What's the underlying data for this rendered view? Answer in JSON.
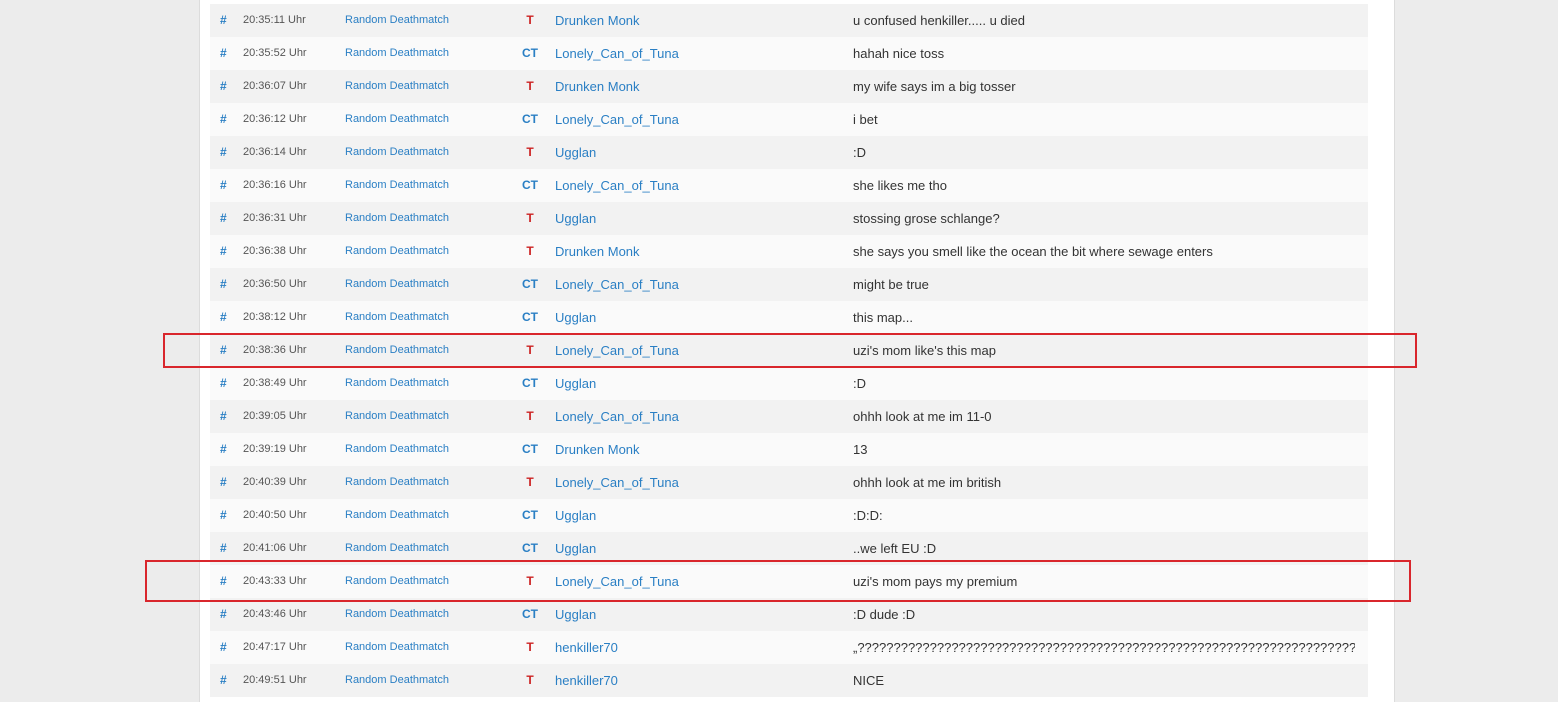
{
  "colors": {
    "link": "#2a7fc4",
    "team_t": "#cc2222",
    "team_ct": "#2a7fc4",
    "highlight": "#d9262c"
  },
  "icons": {
    "scroll_up": "chevron-up-icon"
  },
  "rows": [
    {
      "hash": "#",
      "time": "20:35:11 Uhr",
      "server": "Random Deathmatch",
      "team": "T",
      "player": "Drunken Monk",
      "message": "u confused henkiller..... u died"
    },
    {
      "hash": "#",
      "time": "20:35:52 Uhr",
      "server": "Random Deathmatch",
      "team": "CT",
      "player": "Lonely_Can_of_Tuna",
      "message": "hahah nice toss"
    },
    {
      "hash": "#",
      "time": "20:36:07 Uhr",
      "server": "Random Deathmatch",
      "team": "T",
      "player": "Drunken Monk",
      "message": "my wife says im a big tosser"
    },
    {
      "hash": "#",
      "time": "20:36:12 Uhr",
      "server": "Random Deathmatch",
      "team": "CT",
      "player": "Lonely_Can_of_Tuna",
      "message": "i bet"
    },
    {
      "hash": "#",
      "time": "20:36:14 Uhr",
      "server": "Random Deathmatch",
      "team": "T",
      "player": "Ugglan",
      "message": ":D"
    },
    {
      "hash": "#",
      "time": "20:36:16 Uhr",
      "server": "Random Deathmatch",
      "team": "CT",
      "player": "Lonely_Can_of_Tuna",
      "message": "she likes me tho"
    },
    {
      "hash": "#",
      "time": "20:36:31 Uhr",
      "server": "Random Deathmatch",
      "team": "T",
      "player": "Ugglan",
      "message": "stossing grose schlange?"
    },
    {
      "hash": "#",
      "time": "20:36:38 Uhr",
      "server": "Random Deathmatch",
      "team": "T",
      "player": "Drunken Monk",
      "message": "she says you smell like the ocean the bit where sewage enters"
    },
    {
      "hash": "#",
      "time": "20:36:50 Uhr",
      "server": "Random Deathmatch",
      "team": "CT",
      "player": "Lonely_Can_of_Tuna",
      "message": "might be true"
    },
    {
      "hash": "#",
      "time": "20:38:12 Uhr",
      "server": "Random Deathmatch",
      "team": "CT",
      "player": "Ugglan",
      "message": "this map..."
    },
    {
      "hash": "#",
      "time": "20:38:36 Uhr",
      "server": "Random Deathmatch",
      "team": "T",
      "player": "Lonely_Can_of_Tuna",
      "message": "uzi's mom like's this map"
    },
    {
      "hash": "#",
      "time": "20:38:49 Uhr",
      "server": "Random Deathmatch",
      "team": "CT",
      "player": "Ugglan",
      "message": ":D"
    },
    {
      "hash": "#",
      "time": "20:39:05 Uhr",
      "server": "Random Deathmatch",
      "team": "T",
      "player": "Lonely_Can_of_Tuna",
      "message": "ohhh look at me im 11-0"
    },
    {
      "hash": "#",
      "time": "20:39:19 Uhr",
      "server": "Random Deathmatch",
      "team": "CT",
      "player": "Drunken Monk",
      "message": "13"
    },
    {
      "hash": "#",
      "time": "20:40:39 Uhr",
      "server": "Random Deathmatch",
      "team": "T",
      "player": "Lonely_Can_of_Tuna",
      "message": "ohhh look at me im british"
    },
    {
      "hash": "#",
      "time": "20:40:50 Uhr",
      "server": "Random Deathmatch",
      "team": "CT",
      "player": "Ugglan",
      "message": ":D:D:"
    },
    {
      "hash": "#",
      "time": "20:41:06 Uhr",
      "server": "Random Deathmatch",
      "team": "CT",
      "player": "Ugglan",
      "message": "..we left EU :D"
    },
    {
      "hash": "#",
      "time": "20:43:33 Uhr",
      "server": "Random Deathmatch",
      "team": "T",
      "player": "Lonely_Can_of_Tuna",
      "message": "uzi's mom pays my premium"
    },
    {
      "hash": "#",
      "time": "20:43:46 Uhr",
      "server": "Random Deathmatch",
      "team": "CT",
      "player": "Ugglan",
      "message": ":D dude :D"
    },
    {
      "hash": "#",
      "time": "20:47:17 Uhr",
      "server": "Random Deathmatch",
      "team": "T",
      "player": "henkiller70",
      "message": "„??????????????????????????????????????????????????????????????????????????????????"
    },
    {
      "hash": "#",
      "time": "20:49:51 Uhr",
      "server": "Random Deathmatch",
      "team": "T",
      "player": "henkiller70",
      "message": "NICE"
    }
  ]
}
